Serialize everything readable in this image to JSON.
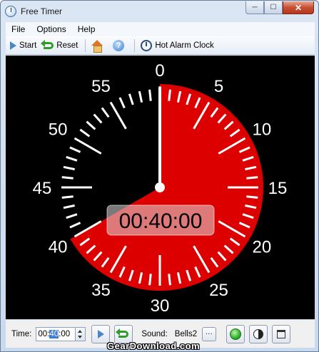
{
  "window": {
    "title": "Free Timer",
    "minimize_glyph": "─",
    "maximize_glyph": "☐",
    "close_glyph": "✕"
  },
  "menu": {
    "items": [
      {
        "label": "File"
      },
      {
        "label": "Options"
      },
      {
        "label": "Help"
      }
    ]
  },
  "toolbar": {
    "start_label": "Start",
    "reset_label": "Reset",
    "home_icon": "home-icon",
    "help_icon": "help-icon",
    "help_glyph": "?",
    "alarm_label": "Hot Alarm Clock"
  },
  "clock": {
    "display_time": "00:40:00",
    "minutes_set": 40,
    "dial_labels": [
      "0",
      "5",
      "10",
      "15",
      "20",
      "25",
      "30",
      "35",
      "40",
      "45",
      "50",
      "55"
    ],
    "colors": {
      "background": "#000000",
      "sector": "#dd0000",
      "ticks": "#ffffff",
      "hand": "#ffffff"
    }
  },
  "bottom": {
    "time_label": "Time:",
    "time_value_prefix": "00:",
    "time_value_selected": "40",
    "time_value_suffix": ":00",
    "sound_label": "Sound:",
    "sound_value": "Bells2",
    "dots_label": "···"
  },
  "watermark": "GearDownload.com"
}
